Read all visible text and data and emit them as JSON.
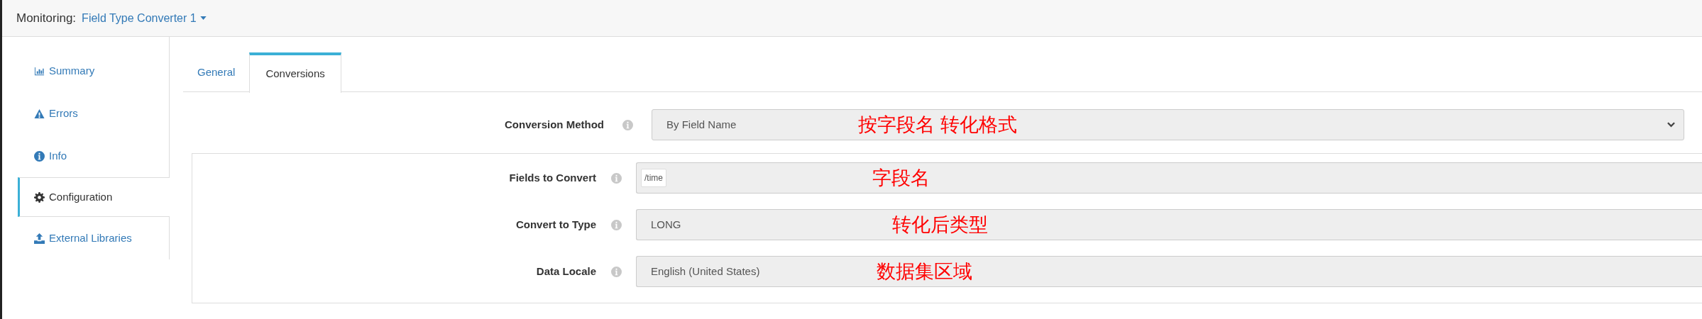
{
  "header": {
    "label": "Monitoring:",
    "stage": "Field Type Converter 1"
  },
  "sidebar": {
    "items": [
      {
        "label": "Summary",
        "kind": "chart",
        "selected": false
      },
      {
        "label": "Errors",
        "kind": "warning",
        "selected": false
      },
      {
        "label": "Info",
        "kind": "info",
        "selected": false
      },
      {
        "label": "Configuration",
        "kind": "gear",
        "selected": true
      },
      {
        "label": "External Libraries",
        "kind": "upload",
        "selected": false
      }
    ]
  },
  "tabs": [
    {
      "label": "General",
      "selected": false
    },
    {
      "label": "Conversions",
      "selected": true
    }
  ],
  "conversion_method": {
    "label": "Conversion Method",
    "value": "By Field Name",
    "annotation": "按字段名 转化格式"
  },
  "conversion_rows": [
    {
      "label": "Fields to Convert",
      "kind": "tags",
      "tags": [
        "/time"
      ],
      "annotation": "字段名"
    },
    {
      "label": "Convert to Type",
      "kind": "text",
      "value": "LONG",
      "annotation": "转化后类型"
    },
    {
      "label": "Data Locale",
      "kind": "text",
      "value": "English (United States)",
      "annotation": "数据集区域"
    }
  ]
}
